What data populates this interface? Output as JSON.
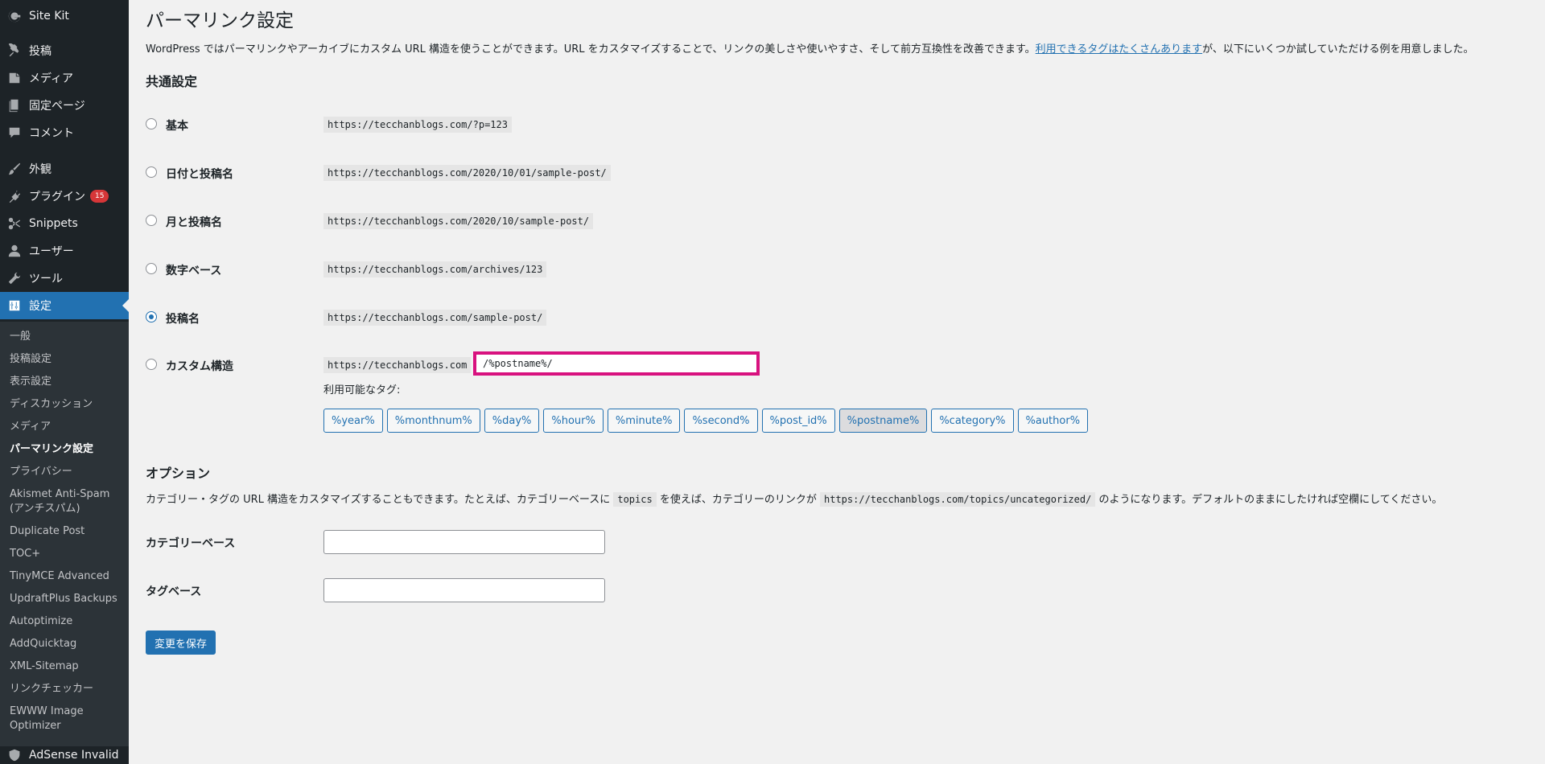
{
  "sidebar": {
    "top_item": "Site Kit",
    "items": [
      {
        "label": "投稿"
      },
      {
        "label": "メディア"
      },
      {
        "label": "固定ページ"
      },
      {
        "label": "コメント"
      },
      {
        "label": "外観"
      },
      {
        "label": "プラグイン",
        "badge": "15"
      },
      {
        "label": "Snippets"
      },
      {
        "label": "ユーザー"
      },
      {
        "label": "ツール"
      },
      {
        "label": "設定"
      }
    ],
    "submenu": [
      "一般",
      "投稿設定",
      "表示設定",
      "ディスカッション",
      "メディア",
      "パーマリンク設定",
      "プライバシー",
      "Akismet Anti-Spam (アンチスパム)",
      "Duplicate Post",
      "TOC+",
      "TinyMCE Advanced",
      "UpdraftPlus Backups",
      "Autoptimize",
      "AddQuicktag",
      "XML-Sitemap",
      "リンクチェッカー",
      "EWWW Image Optimizer"
    ],
    "bottom_item": "AdSense Invalid"
  },
  "page": {
    "title": "パーマリンク設定",
    "intro_before": "WordPress ではパーマリンクやアーカイブにカスタム URL 構造を使うことができます。URL をカスタマイズすることで、リンクの美しさや使いやすさ、そして前方互換性を改善できます。",
    "intro_link": "利用できるタグはたくさんあります",
    "intro_after": "が、以下にいくつか試していただける例を用意しました。"
  },
  "common": {
    "heading": "共通設定",
    "options": [
      {
        "label": "基本",
        "url": "https://tecchanblogs.com/?p=123",
        "checked": false
      },
      {
        "label": "日付と投稿名",
        "url": "https://tecchanblogs.com/2020/10/01/sample-post/",
        "checked": false
      },
      {
        "label": "月と投稿名",
        "url": "https://tecchanblogs.com/2020/10/sample-post/",
        "checked": false
      },
      {
        "label": "数字ベース",
        "url": "https://tecchanblogs.com/archives/123",
        "checked": false
      },
      {
        "label": "投稿名",
        "url": "https://tecchanblogs.com/sample-post/",
        "checked": true
      }
    ],
    "custom": {
      "label": "カスタム構造",
      "base_url": "https://tecchanblogs.com",
      "value": "/%postname%/",
      "available_tags_label": "利用可能なタグ:",
      "tags": [
        "%year%",
        "%monthnum%",
        "%day%",
        "%hour%",
        "%minute%",
        "%second%",
        "%post_id%",
        "%postname%",
        "%category%",
        "%author%"
      ],
      "active_tag": "%postname%"
    }
  },
  "options_section": {
    "heading": "オプション",
    "desc_1": "カテゴリー・タグの URL 構造をカスタマイズすることもできます。たとえば、カテゴリーベースに",
    "desc_code_1": "topics",
    "desc_2": "を使えば、カテゴリーのリンクが",
    "desc_code_2": "https://tecchanblogs.com/topics/uncategorized/",
    "desc_3": "のようになります。デフォルトのままにしたければ空欄にしてください。",
    "category_base_label": "カテゴリーベース",
    "category_base_value": "",
    "tag_base_label": "タグベース",
    "tag_base_value": ""
  },
  "save_button": "変更を保存",
  "colors": {
    "accent": "#2271b1",
    "sidebar_bg": "#1d2327",
    "highlight_border": "#d8127f",
    "badge": "#d63638"
  }
}
